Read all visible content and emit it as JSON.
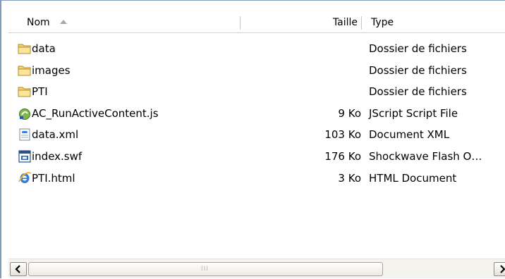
{
  "header": {
    "name_label": "Nom",
    "size_label": "Taille",
    "type_label": "Type"
  },
  "files": [
    {
      "name": "data",
      "size": "",
      "type": "Dossier de fichiers",
      "icon": "folder-icon"
    },
    {
      "name": "images",
      "size": "",
      "type": "Dossier de fichiers",
      "icon": "folder-icon"
    },
    {
      "name": "PTI",
      "size": "",
      "type": "Dossier de fichiers",
      "icon": "folder-icon"
    },
    {
      "name": "AC_RunActiveContent.js",
      "size": "9 Ko",
      "type": "JScript Script File",
      "icon": "jscript-file-icon"
    },
    {
      "name": "data.xml",
      "size": "103 Ko",
      "type": "Document XML",
      "icon": "xml-file-icon"
    },
    {
      "name": "index.swf",
      "size": "176 Ko",
      "type": "Shockwave Flash O…",
      "icon": "flash-file-icon"
    },
    {
      "name": "PTI.html",
      "size": "3 Ko",
      "type": "HTML Document",
      "icon": "internet-explorer-icon"
    }
  ],
  "scrollbar": {
    "grip": "III"
  },
  "colors": {
    "folder": "#f5d374",
    "header_separator": "#c8c6c0",
    "border": "#7f9db9"
  }
}
